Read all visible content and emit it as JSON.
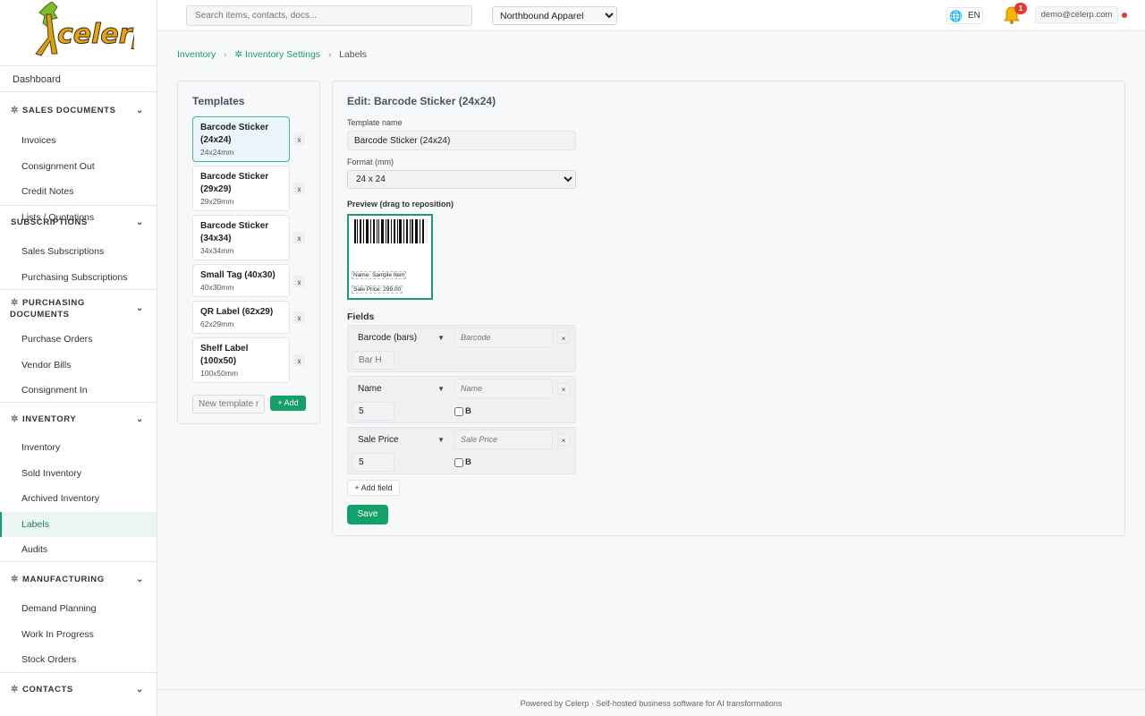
{
  "brand": {
    "logo_text": "celerp",
    "accent": "#14a06b"
  },
  "search": {
    "placeholder": "Search items, contacts, docs..."
  },
  "company": {
    "selected": "Northbound Apparel"
  },
  "language": {
    "label": "EN"
  },
  "notifications": {
    "count": "1"
  },
  "user": {
    "email": "demo@celerp.com"
  },
  "sidebar": {
    "dashboard": "Dashboard",
    "sales_documents": {
      "label": "SALES DOCUMENTS",
      "items": [
        "Invoices",
        "Consignment Out",
        "Credit Notes",
        "Lists / Quotations"
      ]
    },
    "subscriptions": {
      "label": "SUBSCRIPTIONS",
      "items": [
        "Sales Subscriptions",
        "Purchasing Subscriptions"
      ]
    },
    "purchasing_documents": {
      "label_line1": "PURCHASING",
      "label_line2": "DOCUMENTS",
      "items": [
        "Purchase Orders",
        "Vendor Bills",
        "Consignment In"
      ]
    },
    "inventory": {
      "label": "INVENTORY",
      "items": [
        "Inventory",
        "Sold Inventory",
        "Archived Inventory",
        "Labels",
        "Audits"
      ]
    },
    "manufacturing": {
      "label": "MANUFACTURING",
      "items": [
        "Demand Planning",
        "Work In Progress",
        "Stock Orders"
      ]
    },
    "contacts": {
      "label": "CONTACTS"
    }
  },
  "breadcrumb": {
    "items": [
      "Inventory",
      "Inventory Settings",
      "Labels"
    ],
    "separator": "›"
  },
  "templates": {
    "title": "Templates",
    "list": [
      {
        "name": "Barcode Sticker (24x24)",
        "size": "24x24mm",
        "selected": true
      },
      {
        "name": "Barcode Sticker (29x29)",
        "size": "29x29mm"
      },
      {
        "name": "Barcode Sticker (34x34)",
        "size": "34x34mm"
      },
      {
        "name": "Small Tag (40x30)",
        "size": "40x30mm"
      },
      {
        "name": "QR Label (62x29)",
        "size": "62x29mm"
      },
      {
        "name": "Shelf Label (100x50)",
        "size": "100x50mm"
      }
    ],
    "remove_label": "x",
    "new_placeholder": "New template name",
    "add_label": "+ Add"
  },
  "editor": {
    "title": "Edit: Barcode Sticker (24x24)",
    "template_name_label": "Template name",
    "template_name_value": "Barcode Sticker (24x24)",
    "format_label": "Format (mm)",
    "format_value": "24 x 24",
    "preview_label": "Preview (drag to reposition)",
    "preview_fields": [
      "Name: Sample Item",
      "Sale Price: 299.00"
    ],
    "fields_heading": "Fields",
    "fields": [
      {
        "type": "Barcode (bars)",
        "label_placeholder": "Barcode",
        "size_placeholder": "Bar H",
        "remove": "×"
      },
      {
        "type": "Name",
        "label_placeholder": "Name",
        "size": "5",
        "bold": "B",
        "remove": "×"
      },
      {
        "type": "Sale Price",
        "label_placeholder": "Sale Price",
        "size": "5",
        "bold": "B",
        "remove": "×"
      }
    ],
    "add_field_label": "+ Add field",
    "save_label": "Save"
  },
  "footer": {
    "text": "Powered by Celerp · Self-hosted business software for AI transformations"
  }
}
